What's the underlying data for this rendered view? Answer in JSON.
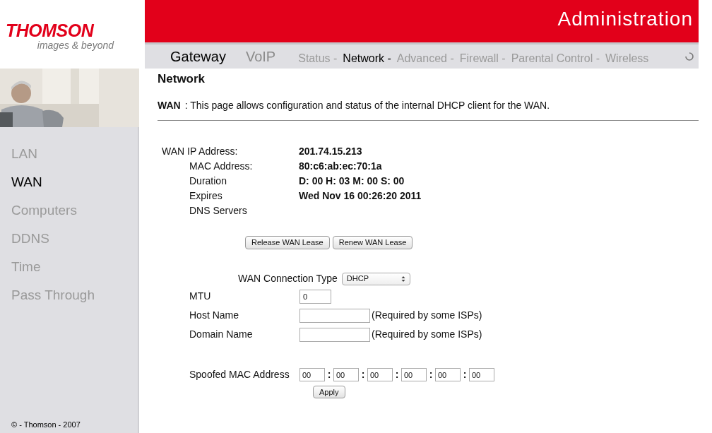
{
  "logo": {
    "brand": "THOMSON",
    "tagline": "images & beyond"
  },
  "header": {
    "title": "Administration"
  },
  "main_tabs": [
    {
      "label": "Gateway",
      "selected": true
    },
    {
      "label": "VoIP",
      "selected": false
    }
  ],
  "sub_nav": [
    {
      "label": "Status -",
      "selected": false
    },
    {
      "label": "Network -",
      "selected": true
    },
    {
      "label": "Advanced -",
      "selected": false
    },
    {
      "label": "Firewall -",
      "selected": false
    },
    {
      "label": "Parental Control -",
      "selected": false
    },
    {
      "label": "Wireless",
      "selected": false
    }
  ],
  "sidebar": {
    "items": [
      {
        "label": "LAN",
        "selected": false
      },
      {
        "label": "WAN",
        "selected": true
      },
      {
        "label": "Computers",
        "selected": false
      },
      {
        "label": "DDNS",
        "selected": false
      },
      {
        "label": "Time",
        "selected": false
      },
      {
        "label": "Pass Through",
        "selected": false
      }
    ],
    "footer": "© - Thomson - 2007"
  },
  "page": {
    "title": "Network",
    "section": "WAN",
    "description": ":  This page allows configuration and status of the internal DHCP client for the WAN."
  },
  "status": [
    {
      "label": "WAN IP Address:",
      "value": "201.74.15.213",
      "indented": false
    },
    {
      "label": "MAC Address:",
      "value": "80:c6:ab:ec:70:1a",
      "indented": true
    },
    {
      "label": "Duration",
      "value": "D: 00 H: 03 M: 00 S: 00",
      "indented": true
    },
    {
      "label": "Expires",
      "value": "Wed Nov 16 00:26:20 2011",
      "indented": true
    },
    {
      "label": "DNS Servers",
      "indented": true
    }
  ],
  "lease_buttons": [
    "Release WAN Lease",
    "Renew WAN Lease"
  ],
  "connection_type": {
    "label": "WAN Connection Type",
    "value": "DHCP"
  },
  "fields": [
    {
      "label": "MTU",
      "value": "0",
      "kind": "short"
    },
    {
      "label": "Host Name",
      "kind": "long",
      "note": "(Required by some ISPs)"
    },
    {
      "label": "Domain Name",
      "kind": "long",
      "note": "(Required by some ISPs)"
    }
  ],
  "spoofed_mac": {
    "label": "Spoofed MAC Address",
    "parts": [
      "00",
      "00",
      "00",
      "00",
      "00",
      "00"
    ],
    "separator": ":"
  },
  "apply_button": "Apply"
}
